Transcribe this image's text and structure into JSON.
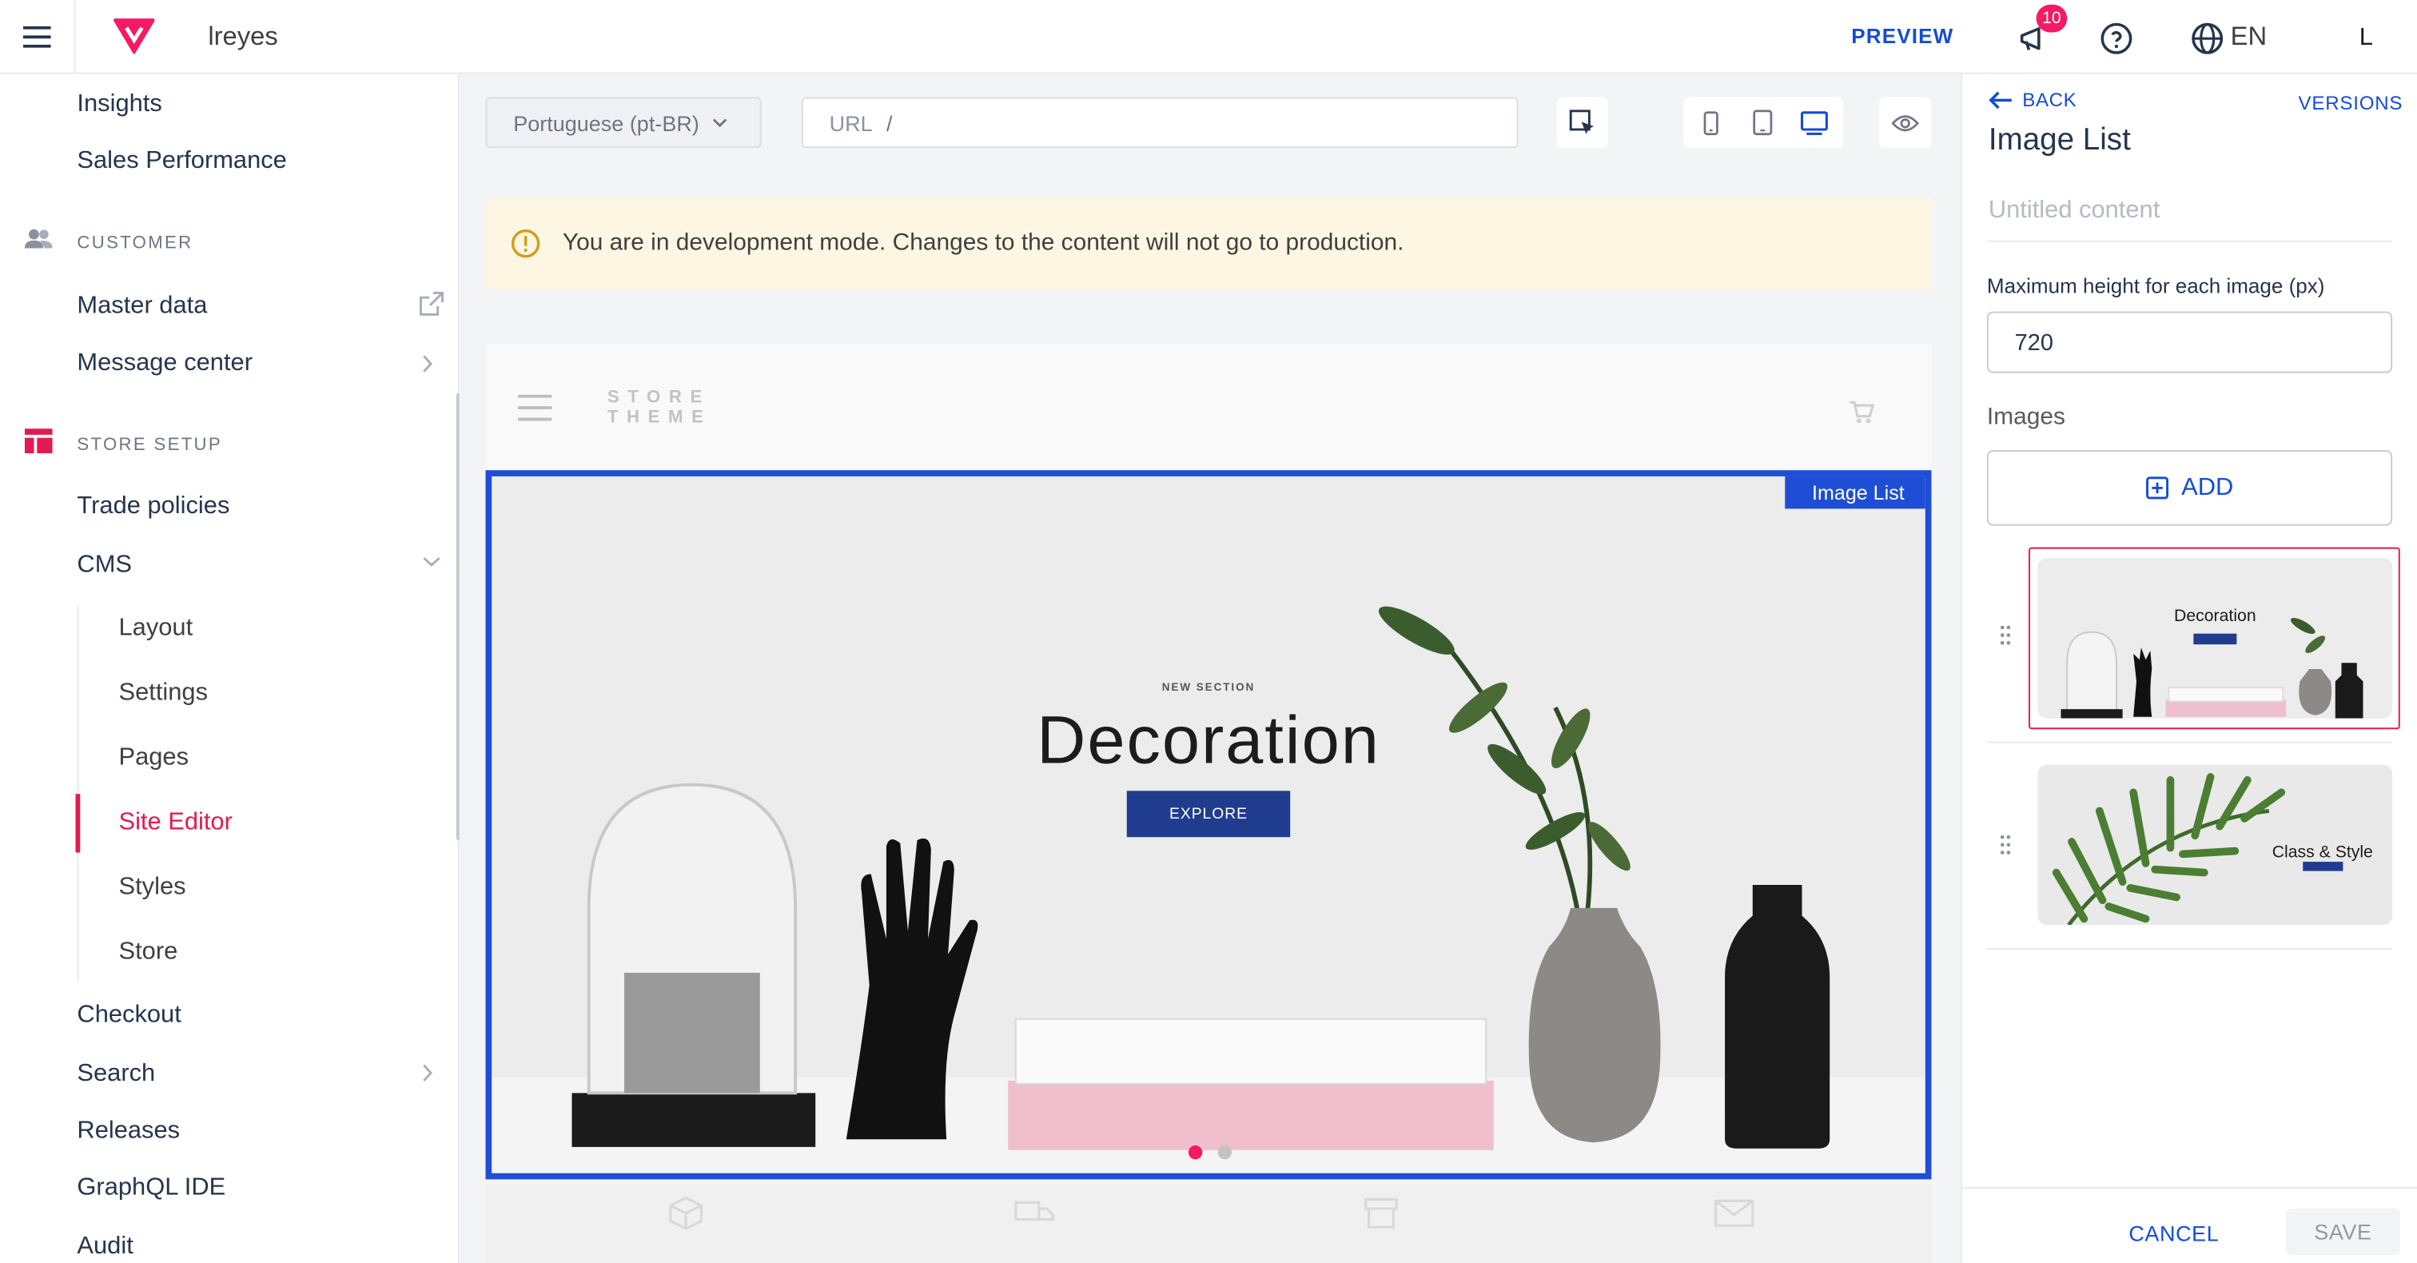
{
  "header": {
    "account_name": "lreyes",
    "preview_label": "PREVIEW",
    "notification_count": "10",
    "language": "EN",
    "avatar_initial": "L",
    "brand_color": "#f71963",
    "accent_color": "#134cd8"
  },
  "sidebar": {
    "items_top": [
      "Insights",
      "Sales Performance"
    ],
    "customer_heading": "CUSTOMER",
    "customer_items": [
      "Master data",
      "Message center"
    ],
    "store_setup_heading": "STORE SETUP",
    "store_items": [
      "Trade policies",
      "CMS"
    ],
    "cms_sub_items": [
      "Layout",
      "Settings",
      "Pages",
      "Site Editor",
      "Styles",
      "Store"
    ],
    "active_item": "Site Editor",
    "bottom_items": [
      "Checkout",
      "Search",
      "Releases",
      "GraphQL IDE",
      "Audit"
    ]
  },
  "editor": {
    "language_select": "Portuguese (pt-BR)",
    "url_label": "URL",
    "url_value": "/",
    "dev_warning": "You are in development mode. Changes to the content will not go to production.",
    "store_logo_line1": "STORE",
    "store_logo_line2": "THEME",
    "selected_block_label": "Image List",
    "banner": {
      "overline": "NEW SECTION",
      "title": "Decoration",
      "cta": "EXPLORE",
      "slide_count": 2,
      "active_slide": 1
    }
  },
  "panel": {
    "back_label": "BACK",
    "versions_label": "VERSIONS",
    "title": "Image List",
    "content_name_placeholder": "Untitled content",
    "max_height_label": "Maximum height for each image (px)",
    "max_height_value": "720",
    "images_label": "Images",
    "add_label": "ADD",
    "images": [
      {
        "caption": "Decoration",
        "selected": true
      },
      {
        "caption": "Class & Style",
        "selected": false
      }
    ],
    "cancel_label": "CANCEL",
    "save_label": "SAVE"
  }
}
